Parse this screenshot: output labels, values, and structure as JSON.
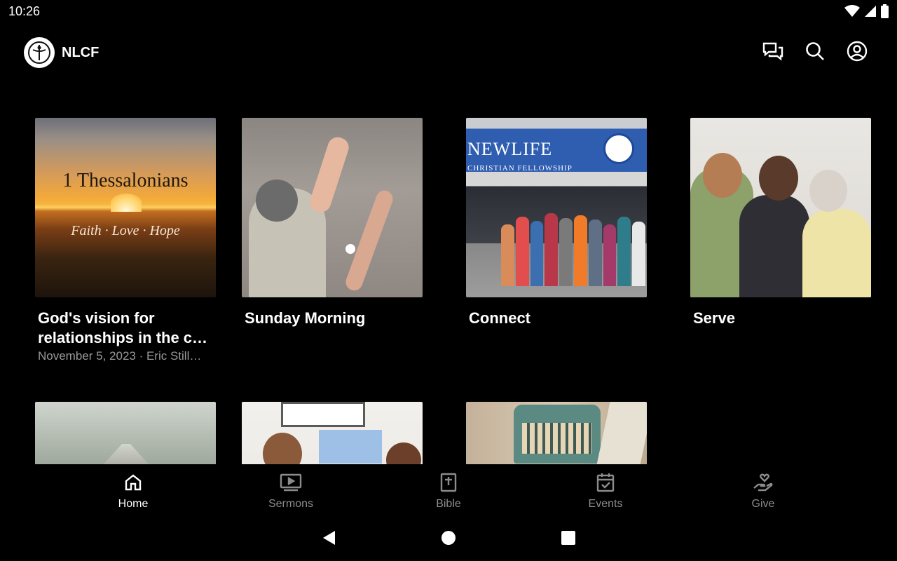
{
  "status_bar": {
    "time": "10:26",
    "icons": [
      "wifi-icon",
      "signal-icon",
      "battery-icon"
    ]
  },
  "app_bar": {
    "title": "NLCF",
    "actions": [
      "messages-icon",
      "search-icon",
      "account-icon"
    ]
  },
  "cards": [
    {
      "title": "God's vision for relationships in the c…",
      "meta": "November 5, 2023 · Eric Still…",
      "thumbnail": {
        "heading": "1 Thessalonians",
        "subheading": "Faith · Love · Hope"
      }
    },
    {
      "title": "Sunday Morning"
    },
    {
      "title": "Connect",
      "thumbnail": {
        "sign_name": "NEWLIFE",
        "sign_sub": "CHRISTIAN FELLOWSHIP"
      }
    },
    {
      "title": "Serve"
    }
  ],
  "bottom_nav": {
    "items": [
      {
        "label": "Home",
        "icon": "home-icon",
        "active": true
      },
      {
        "label": "Sermons",
        "icon": "sermons-icon",
        "active": false
      },
      {
        "label": "Bible",
        "icon": "bible-icon",
        "active": false
      },
      {
        "label": "Events",
        "icon": "events-icon",
        "active": false
      },
      {
        "label": "Give",
        "icon": "give-icon",
        "active": false
      }
    ]
  },
  "system_nav": [
    "back-icon",
    "home-circle-icon",
    "recents-icon"
  ],
  "colors": {
    "background": "#000000",
    "text": "#ffffff",
    "muted_text": "#9a9a9a",
    "inactive_nav": "#8c8c8c"
  }
}
